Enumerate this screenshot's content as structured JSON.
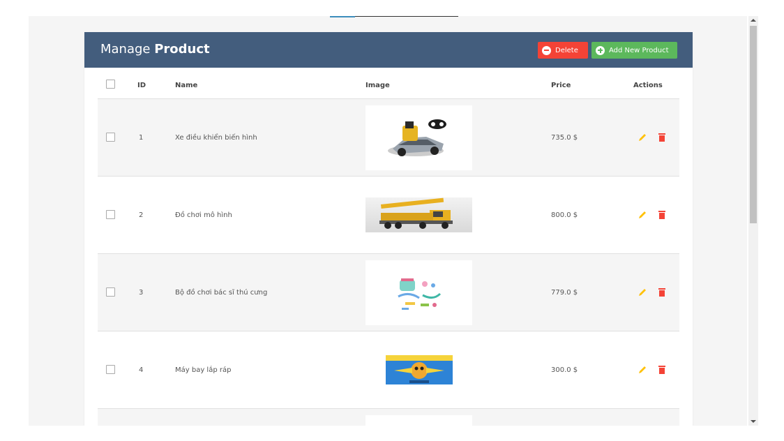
{
  "header": {
    "title_prefix": "Manage ",
    "title_bold": "Product",
    "delete_label": "Delete",
    "add_label": "Add New Product"
  },
  "columns": {
    "id": "ID",
    "name": "Name",
    "image": "Image",
    "price": "Price",
    "actions": "Actions"
  },
  "rows": [
    {
      "id": "1",
      "name": "Xe điều khiển biến hình",
      "price": "735.0 $",
      "image_icon": "transforming-rc-car-image"
    },
    {
      "id": "2",
      "name": "Đồ chơi mô hình",
      "price": "800.0 $",
      "image_icon": "toy-crane-truck-image"
    },
    {
      "id": "3",
      "name": "Bộ đồ chơi bác sĩ thú cưng",
      "price": "779.0 $",
      "image_icon": "pet-doctor-toy-set-image"
    },
    {
      "id": "4",
      "name": "Máy bay lắp ráp",
      "price": "300.0 $",
      "image_icon": "assembly-plane-box-image"
    }
  ],
  "colors": {
    "header_bg": "#435d7d",
    "delete_bg": "#f44336",
    "add_bg": "#5cb85c",
    "edit_icon": "#ffc107",
    "delete_icon": "#f44336"
  }
}
